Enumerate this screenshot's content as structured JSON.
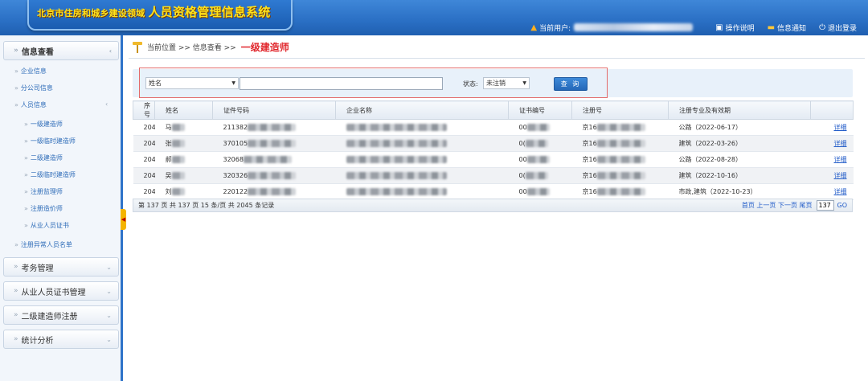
{
  "header": {
    "title_prefix": "北京市住房和城乡建设领域",
    "title_main": "人员资格管理信息系统",
    "current_user_label": "当前用户:",
    "links": [
      {
        "icon": "help-icon",
        "label": "操作说明"
      },
      {
        "icon": "mail-icon",
        "label": "信息通知"
      },
      {
        "icon": "power-icon",
        "label": "退出登录"
      }
    ]
  },
  "sidebar": {
    "sections": [
      {
        "label": "信息查看"
      },
      {
        "label": "考务管理"
      },
      {
        "label": "从业人员证书管理"
      },
      {
        "label": "二级建造师注册"
      },
      {
        "label": "统计分析"
      }
    ],
    "links": [
      {
        "label": "企业信息"
      },
      {
        "label": "分公司信息"
      },
      {
        "label": "人员信息"
      },
      {
        "label": "一级建造师"
      },
      {
        "label": "一级临时建造师"
      },
      {
        "label": "二级建造师"
      },
      {
        "label": "二级临时建造师"
      },
      {
        "label": "注册监理师"
      },
      {
        "label": "注册造价师"
      },
      {
        "label": "从业人员证书"
      },
      {
        "label": "注册异常人员名单"
      }
    ]
  },
  "breadcrumb": {
    "prefix": "当前位置 >> 信息查看 >>",
    "current": "一级建造师"
  },
  "search": {
    "field_select": "姓名",
    "input_value": "",
    "state_label": "状态:",
    "state_select": "未注销",
    "query_button": "查 询"
  },
  "table": {
    "columns": [
      "序号",
      "姓名",
      "证件号码",
      "企业名称",
      "证书编号",
      "注册号",
      "注册专业及有效期",
      ""
    ],
    "rows": [
      {
        "no": "2041",
        "name": "马",
        "id": "211382",
        "cert": "00",
        "reg": "京16",
        "major": "公路（2022-06-17）",
        "action": "详细"
      },
      {
        "no": "2042",
        "name": "张",
        "id": "370105",
        "cert": "0(",
        "reg": "京16",
        "major": "建筑（2022-03-26）",
        "action": "详细"
      },
      {
        "no": "2043",
        "name": "郝",
        "id": "32068",
        "cert": "00",
        "reg": "京16",
        "major": "公路（2022-08-28）",
        "action": "详细"
      },
      {
        "no": "2044",
        "name": "吴",
        "id": "320326",
        "cert": "0(",
        "reg": "京16",
        "major": "建筑（2022-10-16）",
        "action": "详细"
      },
      {
        "no": "2045",
        "name": "刘",
        "id": "220122",
        "cert": "00",
        "reg": "京16",
        "major": "市政,建筑（2022-10-23）",
        "action": "详细"
      }
    ]
  },
  "pager": {
    "summary": "第 137 页  共 137 页  15 条/页  共 2045 条记录",
    "nav": "首页 上一页 下一页 尾页",
    "page_value": "137",
    "go": "GO"
  }
}
